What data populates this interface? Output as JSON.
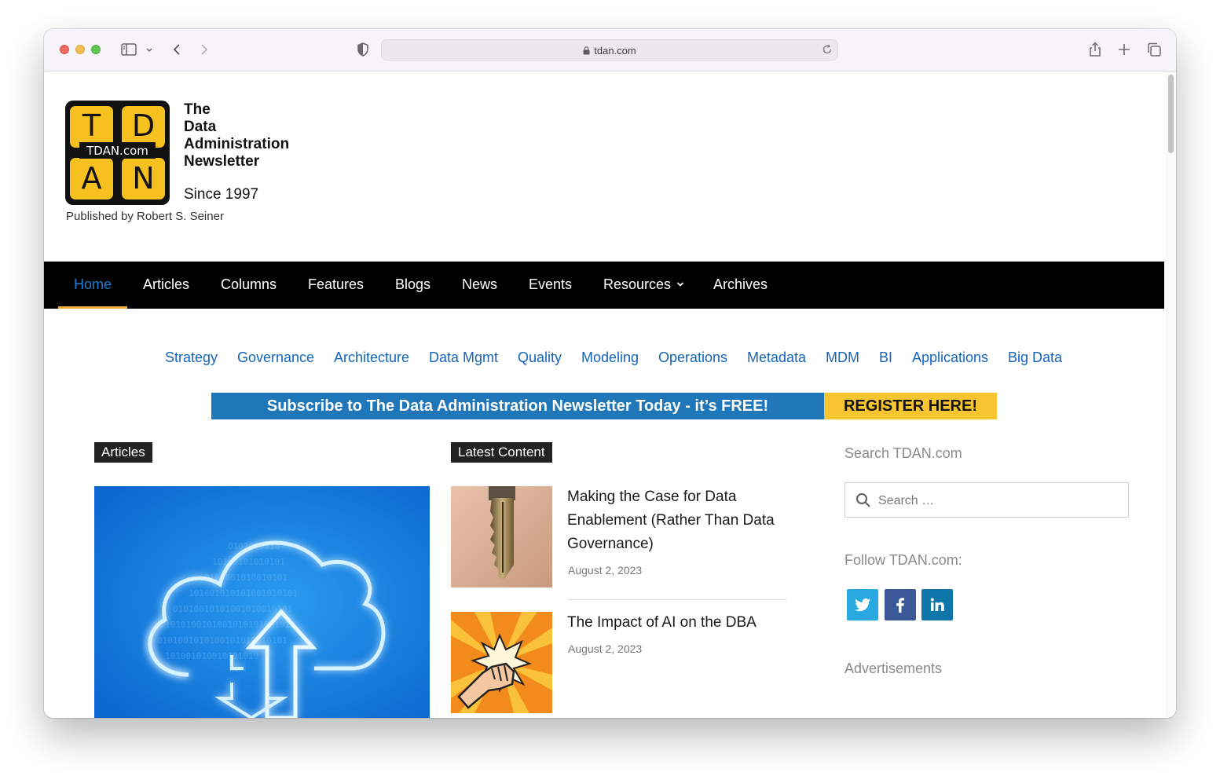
{
  "browser": {
    "url": "tdan.com"
  },
  "header": {
    "logo": {
      "letters": [
        "T",
        "D",
        "A",
        "N"
      ],
      "center_text": "TDAN.com",
      "tile_color": "#f6c01f",
      "frame_color": "#111111"
    },
    "brand_lines": [
      "The",
      "Data",
      "Administration",
      "Newsletter"
    ],
    "since": "Since 1997",
    "publisher": "Published by Robert S. Seiner"
  },
  "nav": {
    "items": [
      {
        "label": "Home",
        "active": true
      },
      {
        "label": "Articles"
      },
      {
        "label": "Columns"
      },
      {
        "label": "Features"
      },
      {
        "label": "Blogs"
      },
      {
        "label": "News"
      },
      {
        "label": "Events"
      },
      {
        "label": "Resources",
        "dropdown": true
      },
      {
        "label": "Archives"
      }
    ],
    "active_color": "#1e7fd0",
    "underline_color": "#f0a93b"
  },
  "categories": [
    "Strategy",
    "Governance",
    "Architecture",
    "Data Mgmt",
    "Quality",
    "Modeling",
    "Operations",
    "Metadata",
    "MDM",
    "BI",
    "Applications",
    "Big Data"
  ],
  "banner": {
    "left_text": "Subscribe to The Data Administration Newsletter Today - it’s FREE!",
    "right_text": "REGISTER HERE!",
    "left_color": "#1f76b9",
    "right_color": "#f6c530"
  },
  "articles_section": {
    "label": "Articles"
  },
  "latest_section": {
    "label": "Latest Content",
    "posts": [
      {
        "title": "Making the Case for Data Enablement (Rather Than Data Governance)",
        "date": "August 2, 2023",
        "thumb": "key-image"
      },
      {
        "title": "The Impact of AI on the DBA",
        "date": "August 2, 2023",
        "thumb": "fist-image"
      }
    ]
  },
  "sidebar": {
    "search_heading": "Search TDAN.com",
    "search_placeholder": "Search …",
    "follow_heading": "Follow TDAN.com:",
    "social": [
      {
        "name": "twitter-icon",
        "color": "#2aa9e0"
      },
      {
        "name": "facebook-icon",
        "color": "#3b5998"
      },
      {
        "name": "linkedin-icon",
        "color": "#0e76a8"
      }
    ],
    "ads_heading": "Advertisements"
  }
}
